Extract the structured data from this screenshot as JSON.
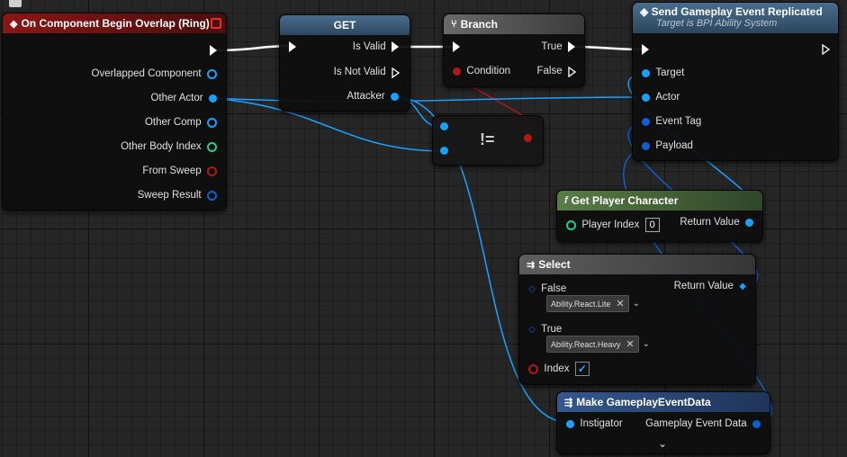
{
  "corner_icon": "comment-icon",
  "nodes": {
    "overlap": {
      "title": "On Component Begin Overlap (Ring)",
      "pins": {
        "overlapped_component": "Overlapped Component",
        "other_actor": "Other Actor",
        "other_comp": "Other Comp",
        "other_body_index": "Other Body Index",
        "from_sweep": "From Sweep",
        "sweep_result": "Sweep Result"
      }
    },
    "get": {
      "title": "GET",
      "pins": {
        "is_valid": "Is Valid",
        "is_not_valid": "Is Not Valid",
        "attacker": "Attacker"
      }
    },
    "branch": {
      "title": "Branch",
      "pins": {
        "condition": "Condition",
        "true": "True",
        "false": "False"
      }
    },
    "not_equal": {
      "symbol": "!="
    },
    "send_event": {
      "title": "Send Gameplay Event Replicated",
      "subtitle": "Target is BPI Ability System",
      "pins": {
        "target": "Target",
        "actor": "Actor",
        "event_tag": "Event Tag",
        "payload": "Payload"
      }
    },
    "get_player_character": {
      "title": "Get Player Character",
      "pins": {
        "player_index": "Player Index",
        "player_index_value": "0",
        "return_value": "Return Value"
      }
    },
    "select": {
      "title": "Select",
      "pins": {
        "false_label": "False",
        "false_value": "Ability.React.Lite",
        "true_label": "True",
        "true_value": "Ability.React.Heavy",
        "index": "Index",
        "return_value": "Return Value"
      }
    },
    "make_event_data": {
      "title": "Make GameplayEventData",
      "pins": {
        "instigator": "Instigator",
        "event_data": "Gameplay Event Data"
      }
    }
  },
  "colors": {
    "object_pin": "#1aa0ff",
    "exec_pin": "#ffffff",
    "bool_pin": "#b0191b",
    "int_pin": "#1fd08a",
    "struct_pin": "#0e5fd1",
    "event_header": "#7d1414",
    "func_header": "#3e5c78",
    "pure_header": "#4d6e40",
    "branch_header": "#5a5a5a",
    "make_header": "#2b4a7a"
  }
}
